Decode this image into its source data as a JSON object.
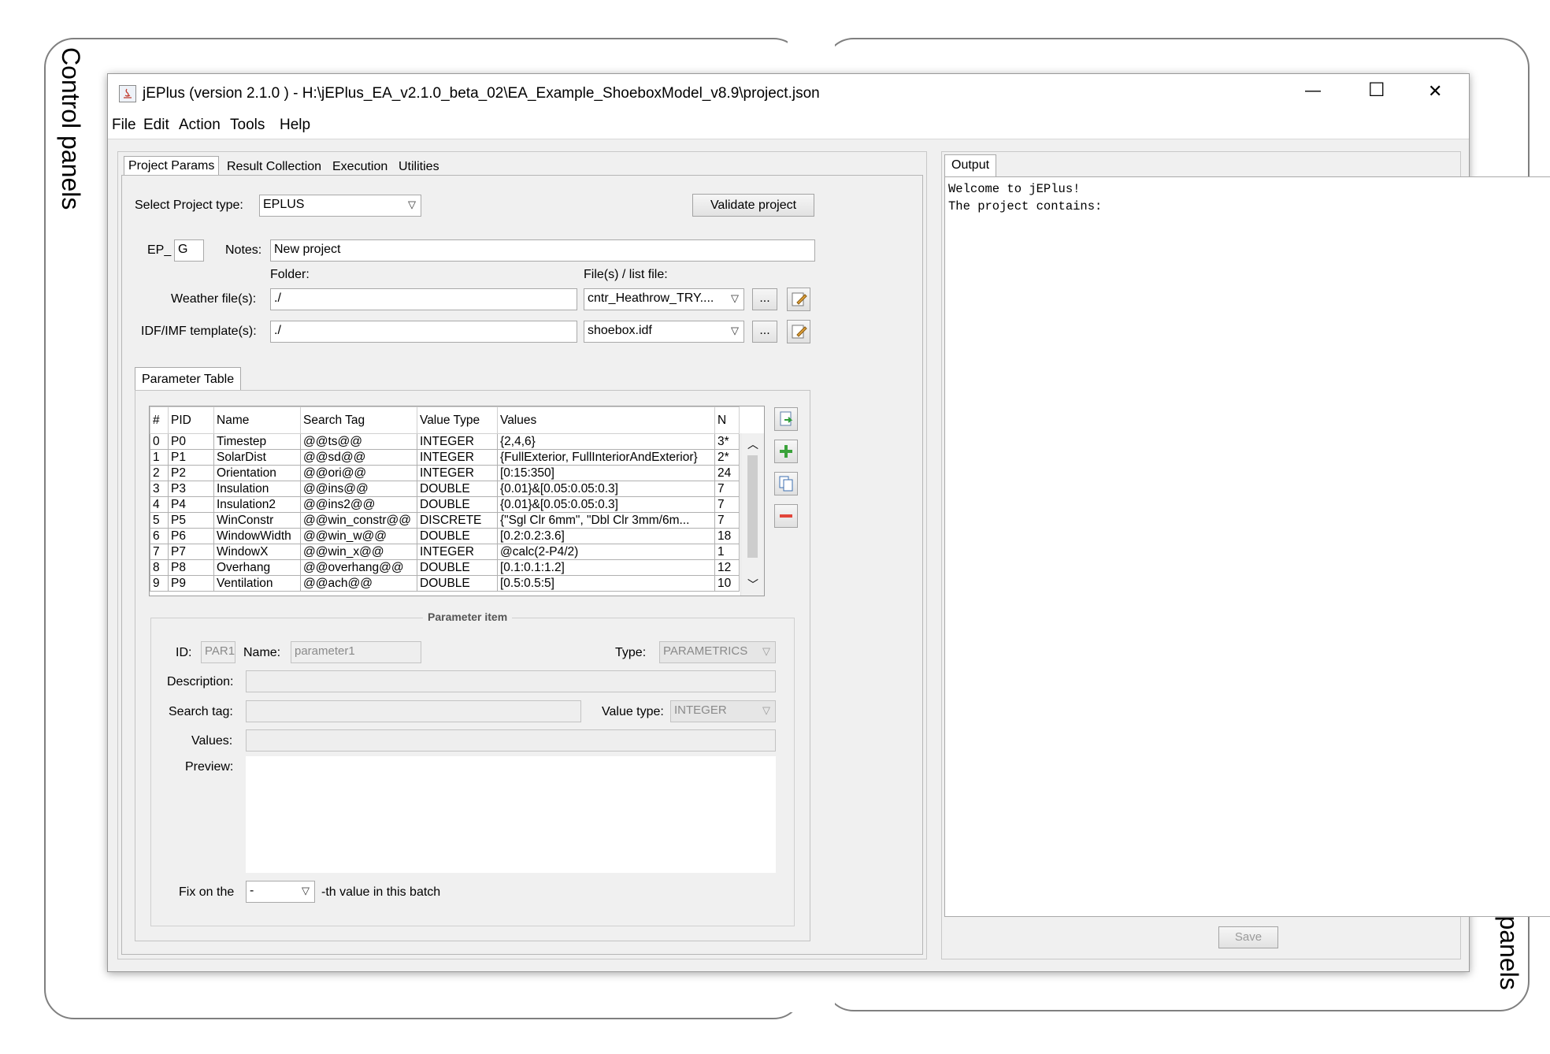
{
  "annotations": {
    "control_label": "Control panels",
    "output_label": "Output/Editor panels"
  },
  "window": {
    "title": "jEPlus (version 2.1.0 )  - H:\\jEPlus_EA_v2.1.0_beta_02\\EA_Example_ShoeboxModel_v8.9\\project.json",
    "minimize_glyph": "—",
    "maximize_glyph": "☐",
    "close_glyph": "✕"
  },
  "menu": [
    "File",
    "Edit",
    "Action",
    "Tools",
    "Help"
  ],
  "tabs": [
    "Project Params",
    "Result Collection",
    "Execution",
    "Utilities"
  ],
  "project": {
    "type_label": "Select Project type:",
    "type_value": "EPLUS",
    "validate_label": "Validate project",
    "ep_prefix": "EP_",
    "ep_value": "G",
    "notes_label": "Notes:",
    "notes_value": "New project",
    "folder_header": "Folder:",
    "files_header": "File(s) / list file:",
    "weather_label": "Weather file(s):",
    "weather_folder": "./",
    "weather_file": "cntr_Heathrow_TRY....",
    "idf_label": "IDF/IMF template(s):",
    "idf_folder": "./",
    "idf_file": "shoebox.idf",
    "browse_label": "..."
  },
  "param_table": {
    "tab_label": "Parameter Table",
    "headers": [
      "#",
      "PID",
      "Name",
      "Search Tag",
      "Value Type",
      "Values",
      "N"
    ],
    "rows": [
      [
        "0",
        "P0",
        "Timestep",
        "@@ts@@",
        "INTEGER",
        "{2,4,6}",
        "3*"
      ],
      [
        "1",
        "P1",
        "SolarDist",
        "@@sd@@",
        "INTEGER",
        "{FullExterior, FullInteriorAndExterior}",
        "2*"
      ],
      [
        "2",
        "P2",
        "Orientation",
        "@@ori@@",
        "INTEGER",
        "[0:15:350]",
        "24"
      ],
      [
        "3",
        "P3",
        "Insulation",
        "@@ins@@",
        "DOUBLE",
        "{0.01}&[0.05:0.05:0.3]",
        "7"
      ],
      [
        "4",
        "P4",
        "Insulation2",
        "@@ins2@@",
        "DOUBLE",
        "{0.01}&[0.05:0.05:0.3]",
        "7"
      ],
      [
        "5",
        "P5",
        "WinConstr",
        "@@win_constr@@",
        "DISCRETE",
        "{\"Sgl Clr 6mm\", \"Dbl Clr 3mm/6m...",
        "7"
      ],
      [
        "6",
        "P6",
        "WindowWidth",
        "@@win_w@@",
        "DOUBLE",
        "[0.2:0.2:3.6]",
        "18"
      ],
      [
        "7",
        "P7",
        "WindowX",
        "@@win_x@@",
        "INTEGER",
        "@calc(2-P4/2)",
        "1"
      ],
      [
        "8",
        "P8",
        "Overhang",
        "@@overhang@@",
        "DOUBLE",
        "[0.1:0.1:1.2]",
        "12"
      ],
      [
        "9",
        "P9",
        "Ventilation",
        "@@ach@@",
        "DOUBLE",
        "[0.5:0.5:5]",
        "10"
      ]
    ]
  },
  "param_item": {
    "title": "Parameter item",
    "id_label": "ID:",
    "id_value": "PAR1",
    "name_label": "Name:",
    "name_value": "parameter1",
    "type_label": "Type:",
    "type_value": "PARAMETRICS",
    "desc_label": "Description:",
    "search_label": "Search tag:",
    "valtype_label": "Value type:",
    "valtype_value": "INTEGER",
    "values_label": "Values:",
    "preview_label": "Preview:",
    "fix_label": "Fix on the",
    "fix_value": "-",
    "fix_suffix": "-th value in this batch"
  },
  "output": {
    "tab_label": "Output",
    "line1": "Welcome to jEPlus!",
    "line2": "The project contains:",
    "save_label": "Save"
  }
}
